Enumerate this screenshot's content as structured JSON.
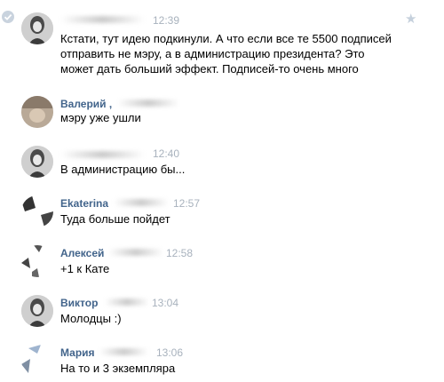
{
  "messages": [
    {
      "sender": "",
      "time": "12:39",
      "lines": [
        "Кстати, тут идею подкинули. А что если все те 5500 подписей",
        "отправить не мэру, а в администрацию президента? Это",
        "может дать больший эффект. Подписей-то очень много"
      ]
    },
    {
      "sender": "Валерий ,",
      "time": "",
      "lines": [
        "мэру уже ушли"
      ]
    },
    {
      "sender": "",
      "time": "12:40",
      "lines": [
        "В администрацию бы..."
      ]
    },
    {
      "sender": "Ekaterina",
      "time": "12:57",
      "lines": [
        "Туда больше пойдет"
      ]
    },
    {
      "sender": "Алексей",
      "time": "12:58",
      "lines": [
        "+1 к Кате"
      ]
    },
    {
      "sender": "Виктор",
      "time": "13:04",
      "lines": [
        "Молодцы :)"
      ]
    },
    {
      "sender": "Мария",
      "time": "13:06",
      "lines": [
        "На то и 3 экземпляра"
      ]
    }
  ],
  "icons": {
    "read_status": "check-circle-icon",
    "favorite": "star-icon",
    "star_glyph": "★"
  },
  "colors": {
    "name": "#42648b",
    "time": "#a8b2bd",
    "text": "#000000",
    "background": "#ffffff"
  }
}
